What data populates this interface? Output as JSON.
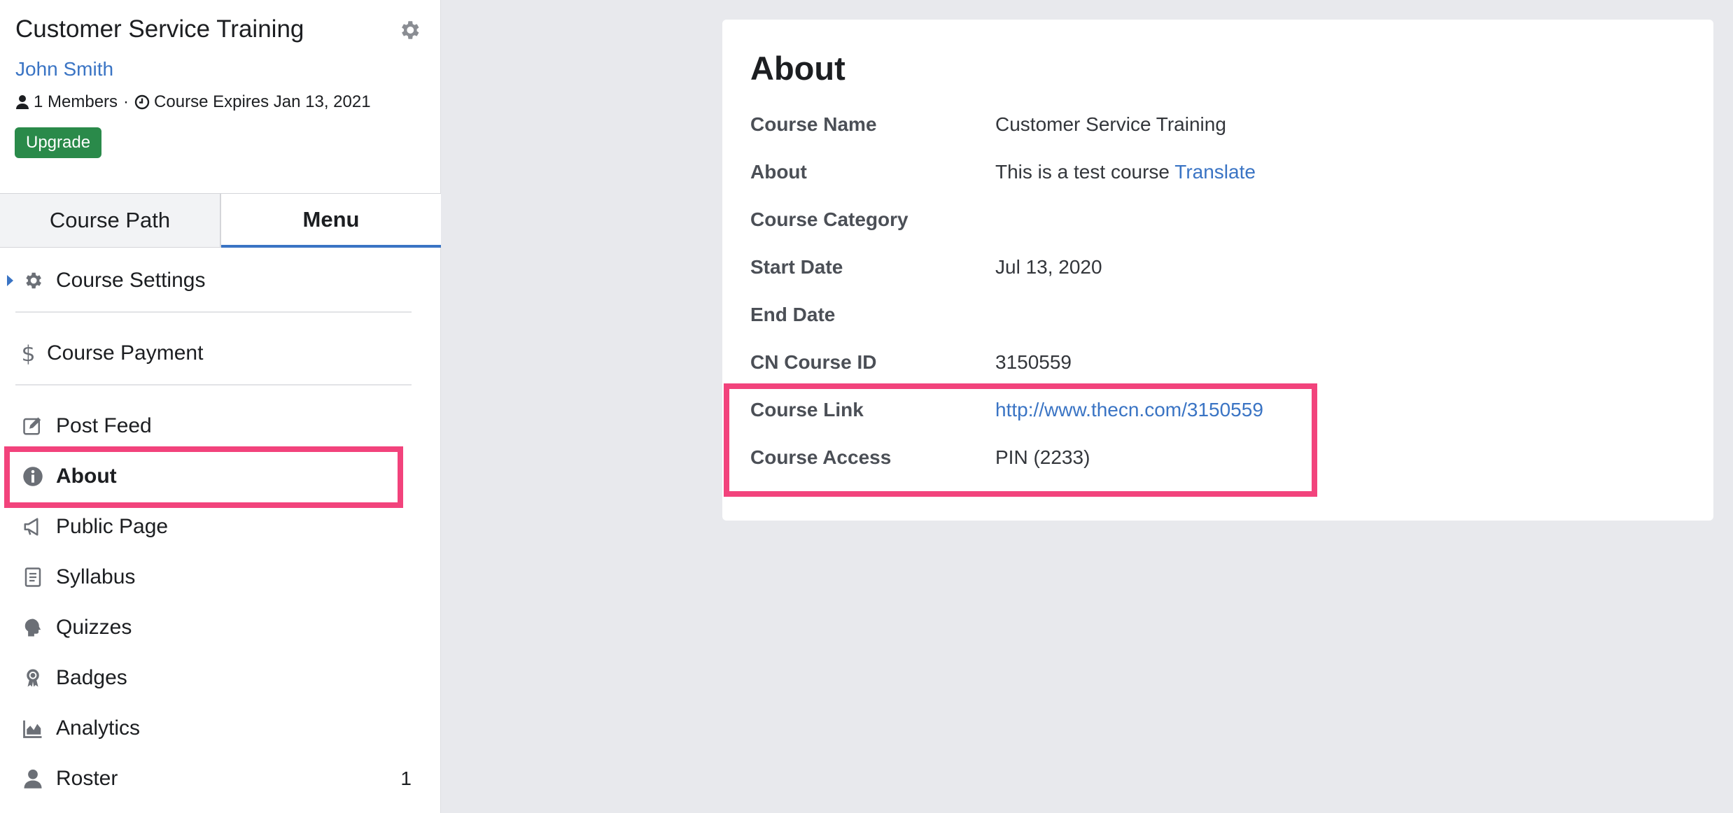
{
  "course": {
    "title": "Customer Service Training",
    "owner": "John Smith",
    "members_text": "1 Members",
    "separator": "·",
    "expires_text": "Course Expires Jan 13, 2021",
    "upgrade_label": "Upgrade"
  },
  "tabs": [
    {
      "label": "Course Path",
      "active": false
    },
    {
      "label": "Menu",
      "active": true
    }
  ],
  "menu": {
    "items": [
      {
        "label": "Course Settings",
        "icon": "gear-icon"
      },
      {
        "label": "Course Payment",
        "icon": "dollar-icon"
      },
      {
        "label": "Post Feed",
        "icon": "edit-icon"
      },
      {
        "label": "About",
        "icon": "info-icon",
        "active": true
      },
      {
        "label": "Public Page",
        "icon": "megaphone-icon"
      },
      {
        "label": "Syllabus",
        "icon": "document-icon"
      },
      {
        "label": "Quizzes",
        "icon": "brain-icon"
      },
      {
        "label": "Badges",
        "icon": "badge-icon"
      },
      {
        "label": "Analytics",
        "icon": "chart-icon"
      },
      {
        "label": "Roster",
        "icon": "user-icon",
        "count": "1"
      }
    ]
  },
  "about": {
    "title": "About",
    "rows": [
      {
        "label": "Course Name",
        "value": "Customer Service Training"
      },
      {
        "label": "About",
        "value": "This is a test course",
        "link": "Translate"
      },
      {
        "label": "Course Category",
        "value": ""
      },
      {
        "label": "Start Date",
        "value": "Jul 13, 2020"
      },
      {
        "label": "End Date",
        "value": ""
      },
      {
        "label": "CN Course ID",
        "value": "3150559"
      },
      {
        "label": "Course Link",
        "link": "http://www.thecn.com/3150559"
      },
      {
        "label": "Course Access",
        "value": "PIN (2233)"
      }
    ]
  },
  "colors": {
    "link": "#3a74c4",
    "upgrade": "#2a8a4a",
    "highlight": "#f2437c",
    "background": "#e8e9ed"
  }
}
